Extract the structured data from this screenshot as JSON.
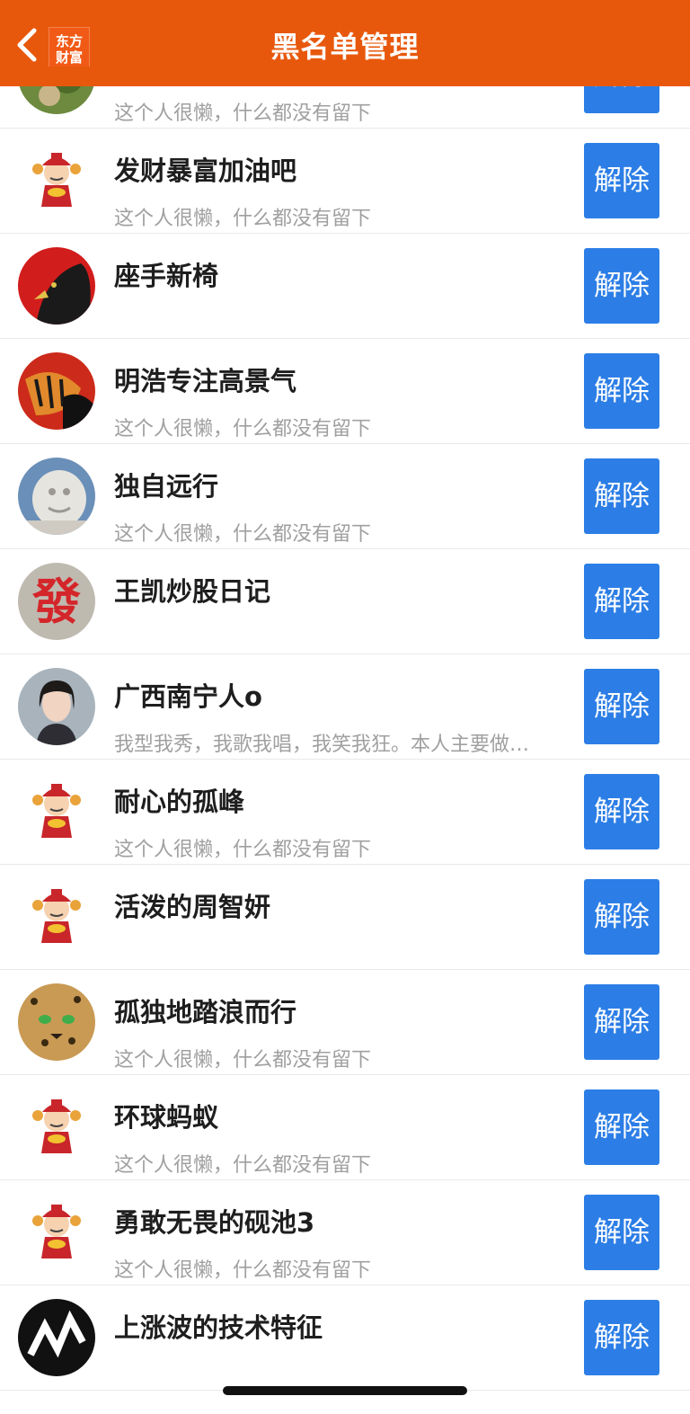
{
  "header": {
    "title": "黑名单管理",
    "logo": "东方\n财富",
    "colors": {
      "bg": "#e8580c",
      "button": "#2c7ee6"
    }
  },
  "button_label": "解除",
  "users": [
    {
      "name": "",
      "desc": "这个人很懒，什么都没有留下",
      "avatar": "plant-avatar"
    },
    {
      "name": "发财暴富加油吧",
      "desc": "这个人很懒，什么都没有留下",
      "avatar": "fortune-god-avatar"
    },
    {
      "name": "座手新椅",
      "desc": "",
      "avatar": "eagle-avatar"
    },
    {
      "name": "明浩专注高景气",
      "desc": "这个人很懒，什么都没有留下",
      "avatar": "tiger-avatar"
    },
    {
      "name": "独自远行",
      "desc": "这个人很懒，什么都没有留下",
      "avatar": "stone-lion-avatar"
    },
    {
      "name": "王凯炒股日记",
      "desc": "",
      "avatar": "fa-character-avatar"
    },
    {
      "name": "广西南宁人o",
      "desc": "我型我秀，我歌我唱，我笑我狂。本人主要做…",
      "avatar": "woman-photo-avatar"
    },
    {
      "name": "耐心的孤峰",
      "desc": "这个人很懒，什么都没有留下",
      "avatar": "fortune-god-avatar"
    },
    {
      "name": "活泼的周智妍",
      "desc": "",
      "avatar": "fortune-god-avatar"
    },
    {
      "name": "孤独地踏浪而行",
      "desc": "这个人很懒，什么都没有留下",
      "avatar": "leopard-avatar"
    },
    {
      "name": "环球蚂蚁",
      "desc": "这个人很懒，什么都没有留下",
      "avatar": "fortune-god-avatar"
    },
    {
      "name": "勇敢无畏的砚池3",
      "desc": "这个人很懒，什么都没有留下",
      "avatar": "fortune-god-avatar"
    },
    {
      "name": "上涨波的技术特征",
      "desc": "",
      "avatar": "wave-logo-avatar"
    }
  ]
}
